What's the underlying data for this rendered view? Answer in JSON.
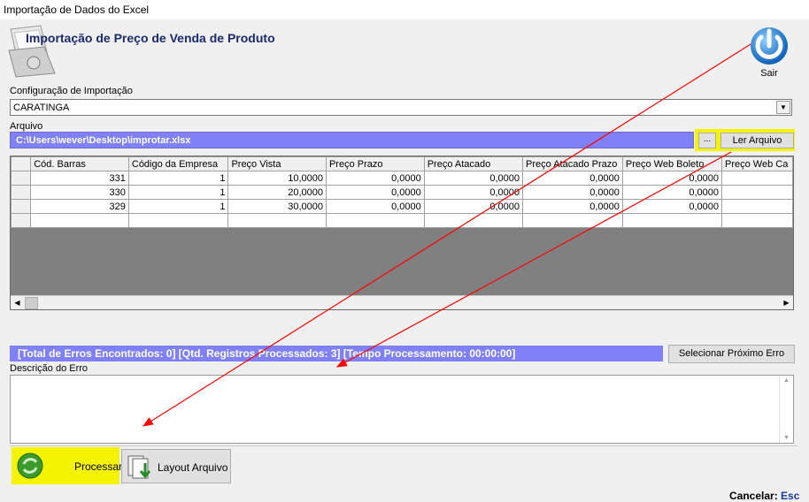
{
  "window": {
    "title": "Importação de Dados do Excel"
  },
  "header": {
    "title": "Importação de Preço de Venda de Produto",
    "exit_label": "Sair"
  },
  "config": {
    "label": "Configuração de Importação",
    "selected": "CARATINGA"
  },
  "file": {
    "label": "Arquivo",
    "path": "C:\\Users\\wever\\Desktop\\improtar.xlsx",
    "browse_label": "...",
    "read_label": "Ler Arquivo"
  },
  "grid": {
    "columns": [
      "Cód. Barras",
      "Código da Empresa",
      "Preço Vista",
      "Preço Prazo",
      "Preço Atacado",
      "Preço Atacado Prazo",
      "Preço Web Boleto",
      "Preço Web Ca"
    ],
    "rows": [
      [
        "331",
        "1",
        "10,0000",
        "0,0000",
        "0,0000",
        "0,0000",
        "0,0000"
      ],
      [
        "330",
        "1",
        "20,0000",
        "0,0000",
        "0,0000",
        "0,0000",
        "0,0000"
      ],
      [
        "329",
        "1",
        "30,0000",
        "0,0000",
        "0,0000",
        "0,0000",
        "0,0000"
      ]
    ]
  },
  "status": {
    "text": "[Total de Erros Encontrados: 0]   [Qtd. Registros Processados: 3]   [Tempo Processamento: 00:00:00]",
    "next_error_label": "Selecionar Próximo Erro"
  },
  "error": {
    "label": "Descrição do Erro",
    "value": ""
  },
  "footer": {
    "process_label": "Processar",
    "layout_label": "Layout Arquivo",
    "cancel_label": "Cancelar:",
    "cancel_key": "Esc"
  },
  "colors": {
    "highlight": "#f4f400",
    "field_blue": "#8080f8",
    "arrow": "#ff0000"
  }
}
